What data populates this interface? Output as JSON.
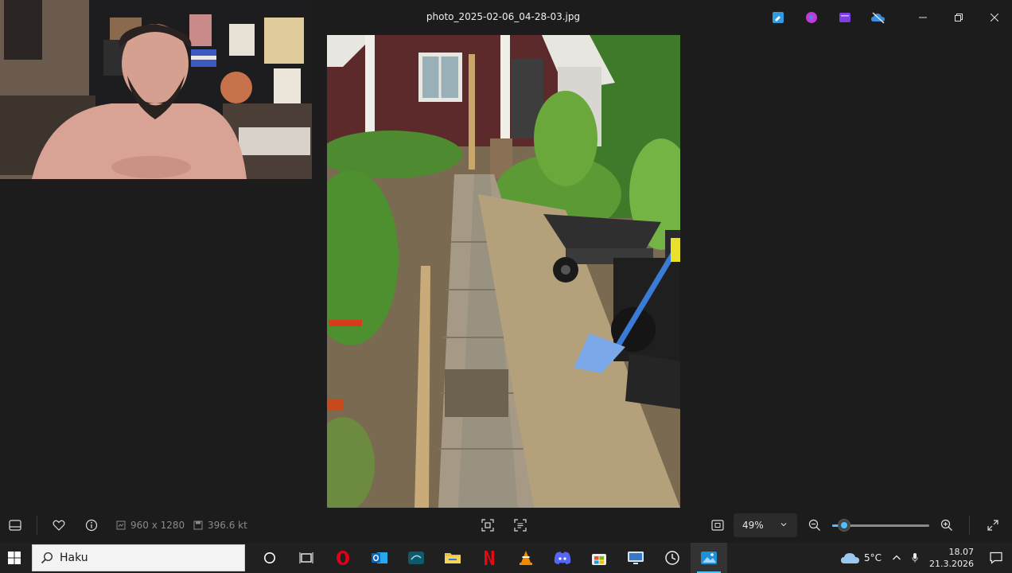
{
  "window": {
    "title": "photo_2025-02-06_04-28-03.jpg",
    "controls": [
      "minimize-icon",
      "restore-icon",
      "close-icon"
    ],
    "app_icons": [
      "edit-image-icon",
      "clipchamp-icon",
      "create-video-icon",
      "onedrive-icon"
    ]
  },
  "toolbar": {
    "dimensions": "960 x 1280",
    "file_size": "396.6 kt",
    "zoom_label": "49%",
    "zoom_level": 0.12,
    "icons": [
      "filmstrip-icon",
      "favorite-icon",
      "info-icon",
      "crop-icon",
      "ocr-icon",
      "fit-screen-icon",
      "zoom-out-icon",
      "zoom-in-icon",
      "fullscreen-icon"
    ]
  },
  "taskbar": {
    "search_placeholder": "Haku",
    "apps": [
      "cortana-icon",
      "task-view-icon",
      "opera-icon",
      "outlook-icon",
      "disney-plus-icon",
      "file-explorer-icon",
      "netflix-icon",
      "vlc-icon",
      "discord-icon",
      "microsoft-store-icon",
      "remote-desktop-icon",
      "clock-app-icon",
      "photos-icon"
    ],
    "weather": "5°C",
    "time": "18.07",
    "date": "21.3.2026"
  },
  "colors": {
    "accent": "#4cc2ff",
    "background": "#1c1c1c",
    "taskbar": "#202020"
  }
}
